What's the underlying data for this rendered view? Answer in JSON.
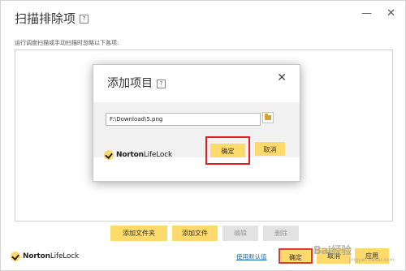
{
  "outer": {
    "title": "扫描排除项",
    "help": "?",
    "minimize": "—",
    "close": "✕",
    "description": "运行调度扫描或手动扫描时忽略以下各项:",
    "actions": {
      "add_folder": "添加文件夹",
      "add_file": "添加文件",
      "edit": "编辑",
      "delete": "删除"
    },
    "footer": {
      "brand_bold": "Norton",
      "brand_thin": "LifeLock",
      "default_link": "使用默认值",
      "ok": "确定",
      "cancel": "取消",
      "apply": "应用"
    }
  },
  "modal": {
    "title": "添加项目",
    "help": "?",
    "close": "✕",
    "path_value": "F:\\Download\\5.png",
    "brand_bold": "Norton",
    "brand_thin": "LifeLock",
    "ok": "确定",
    "cancel": "取消"
  },
  "watermark": {
    "text": "Bai经验",
    "sub": "jingyan.baidu.com"
  },
  "colors": {
    "button_yellow": "#fed96b",
    "highlight_red": "#e11d1d",
    "link_blue": "#1d6fb8"
  }
}
